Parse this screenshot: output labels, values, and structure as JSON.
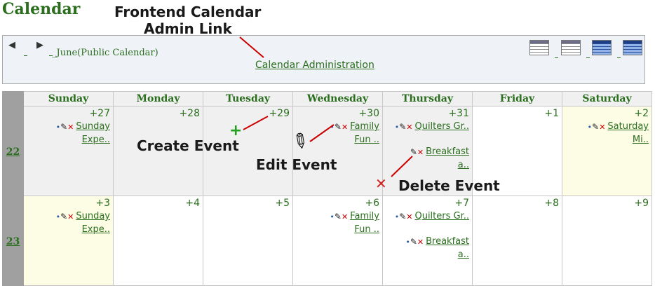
{
  "page": {
    "title": "Calendar"
  },
  "header": {
    "month_label": "_June(Public Calendar)",
    "admin_link": "Calendar Administration",
    "prev_icon": "triangle-left-icon",
    "next_icon": "triangle-right-icon"
  },
  "view_icons": [
    "year-view-icon",
    "month-view-icon",
    "week-view-icon",
    "day-view-icon"
  ],
  "days": [
    "Sunday",
    "Monday",
    "Tuesday",
    "Wednesday",
    "Thursday",
    "Friday",
    "Saturday"
  ],
  "weeks": [
    {
      "number": "22",
      "cells": [
        {
          "day": "+27",
          "events": [
            {
              "line1": "Sunday",
              "line2": "Expe.."
            }
          ]
        },
        {
          "day": "+28",
          "events": []
        },
        {
          "day": "+29",
          "events": []
        },
        {
          "day": "+30",
          "events": [
            {
              "line1": "Family",
              "line2": "Fun .."
            }
          ]
        },
        {
          "day": "+31",
          "events": [
            {
              "line1": "Quilters Gr..",
              "line2": ""
            },
            {
              "line1": "Breakfast",
              "line2": "a.."
            }
          ]
        },
        {
          "day": "+1",
          "events": []
        },
        {
          "day": "+2",
          "events": [
            {
              "line1": "Saturday",
              "line2": "Mi.."
            }
          ]
        }
      ]
    },
    {
      "number": "23",
      "cells": [
        {
          "day": "+3",
          "events": [
            {
              "line1": "Sunday",
              "line2": "Expe.."
            }
          ]
        },
        {
          "day": "+4",
          "events": []
        },
        {
          "day": "+5",
          "events": []
        },
        {
          "day": "+6",
          "events": [
            {
              "line1": "Family",
              "line2": "Fun .."
            }
          ]
        },
        {
          "day": "+7",
          "events": [
            {
              "line1": "Quilters Gr..",
              "line2": ""
            },
            {
              "line1": "Breakfast",
              "line2": "a.."
            }
          ]
        },
        {
          "day": "+8",
          "events": []
        },
        {
          "day": "+9",
          "events": []
        }
      ]
    }
  ],
  "annotations": {
    "frontend_line1": "Frontend Calendar",
    "frontend_line2": "Admin Link",
    "create_event": "Create Event",
    "edit_event": "Edit Event",
    "delete_event": "Delete Event"
  },
  "colors": {
    "link_green": "#2a6e1e",
    "annotation_line": "#cc0000",
    "today_highlight": "#fdfde6"
  }
}
